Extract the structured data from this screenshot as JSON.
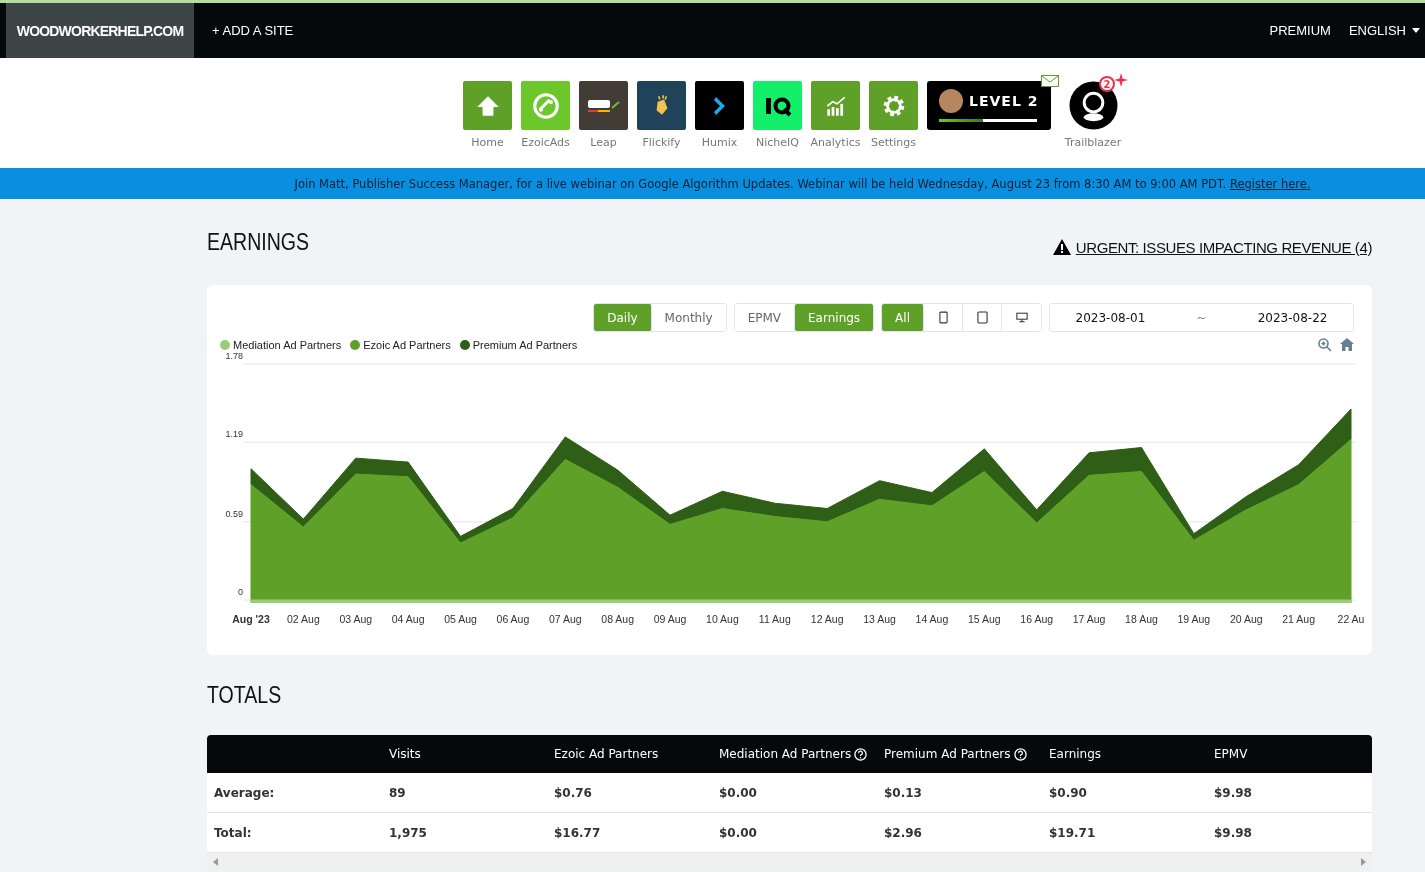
{
  "top_nav": {
    "site": "WOODWORKERHELP.COM",
    "add_site": "+ ADD A SITE",
    "premium": "PREMIUM",
    "language": "ENGLISH"
  },
  "apps": [
    {
      "label": "Home",
      "kind": "home"
    },
    {
      "label": "EzoicAds",
      "kind": "ezoic"
    },
    {
      "label": "Leap",
      "kind": "leap"
    },
    {
      "label": "Flickify",
      "kind": "flickify"
    },
    {
      "label": "Humix",
      "kind": "humix"
    },
    {
      "label": "NicheIQ",
      "kind": "nicheiq"
    },
    {
      "label": "Analytics",
      "kind": "analytics"
    },
    {
      "label": "Settings",
      "kind": "settings"
    }
  ],
  "level_badge": {
    "text": "LEVEL 2",
    "level": 0.45
  },
  "trailblazer": {
    "label": "Trailblazer",
    "badge": "2"
  },
  "banner": {
    "text": "Join Matt, Publisher Success Manager, for a live webinar on Google Algorithm Updates. Webinar will be held Wednesday, August 23 from 8:30 AM to 9:00 AM PDT.",
    "link": "Register here."
  },
  "earnings": {
    "title": "EARNINGS",
    "alert": "URGENT: ISSUES IMPACTING REVENUE (4)",
    "period_tabs": [
      {
        "label": "Daily",
        "selected": true
      },
      {
        "label": "Monthly",
        "selected": false
      }
    ],
    "metric_tabs": [
      {
        "label": "EPMV",
        "selected": false
      },
      {
        "label": "Earnings",
        "selected": true
      }
    ],
    "device_tabs": [
      {
        "kind": "all",
        "label": "All",
        "selected": true
      },
      {
        "kind": "phone",
        "selected": false
      },
      {
        "kind": "tablet",
        "selected": false
      },
      {
        "kind": "desktop",
        "selected": false
      }
    ],
    "date_from": "2023-08-01",
    "date_separator": "~",
    "date_to": "2023-08-22",
    "chart_data": {
      "type": "area",
      "stacked": true,
      "categories": [
        "Aug '23",
        "02 Aug",
        "03 Aug",
        "04 Aug",
        "05 Aug",
        "06 Aug",
        "07 Aug",
        "08 Aug",
        "09 Aug",
        "10 Aug",
        "11 Aug",
        "12 Aug",
        "13 Aug",
        "14 Aug",
        "15 Aug",
        "16 Aug",
        "17 Aug",
        "18 Aug",
        "19 Aug",
        "20 Aug",
        "21 Aug",
        "22 Au"
      ],
      "yticks": [
        0,
        0.59,
        1.19,
        1.78
      ],
      "ylim": [
        0,
        1.78
      ],
      "series": [
        {
          "name": "Mediation Ad Partners",
          "color": "#9ccc7a",
          "values": [
            0,
            0,
            0,
            0,
            0,
            0,
            0,
            0,
            0,
            0,
            0,
            0,
            0,
            0,
            0,
            0,
            0,
            0,
            0,
            0,
            0,
            0
          ]
        },
        {
          "name": "Ezoic Ad Partners",
          "color": "#5fa128",
          "values": [
            0.87,
            0.55,
            0.95,
            0.93,
            0.43,
            0.62,
            1.06,
            0.85,
            0.57,
            0.69,
            0.63,
            0.59,
            0.76,
            0.71,
            0.97,
            0.58,
            0.94,
            0.97,
            0.45,
            0.68,
            0.87,
            1.21
          ]
        },
        {
          "name": "Premium Ad Partners",
          "color": "#2f5e16",
          "values": [
            0.12,
            0.06,
            0.12,
            0.11,
            0.05,
            0.07,
            0.17,
            0.13,
            0.07,
            0.13,
            0.1,
            0.1,
            0.14,
            0.1,
            0.17,
            0.1,
            0.17,
            0.18,
            0.05,
            0.1,
            0.15,
            0.23
          ]
        }
      ]
    }
  },
  "totals": {
    "title": "TOTALS",
    "columns": [
      {
        "label": "Visits",
        "help": false
      },
      {
        "label": "Ezoic Ad Partners",
        "help": false
      },
      {
        "label": "Mediation Ad Partners",
        "help": true
      },
      {
        "label": "Premium Ad Partners",
        "help": true
      },
      {
        "label": "Earnings",
        "help": false
      },
      {
        "label": "EPMV",
        "help": false
      }
    ],
    "rows": [
      {
        "label": "Average:",
        "cells": [
          "89",
          "$0.76",
          "$0.00",
          "$0.13",
          "$0.90",
          "$9.98"
        ]
      },
      {
        "label": "Total:",
        "cells": [
          "1,975",
          "$16.77",
          "$0.00",
          "$2.96",
          "$19.71",
          "$9.98"
        ]
      }
    ]
  }
}
